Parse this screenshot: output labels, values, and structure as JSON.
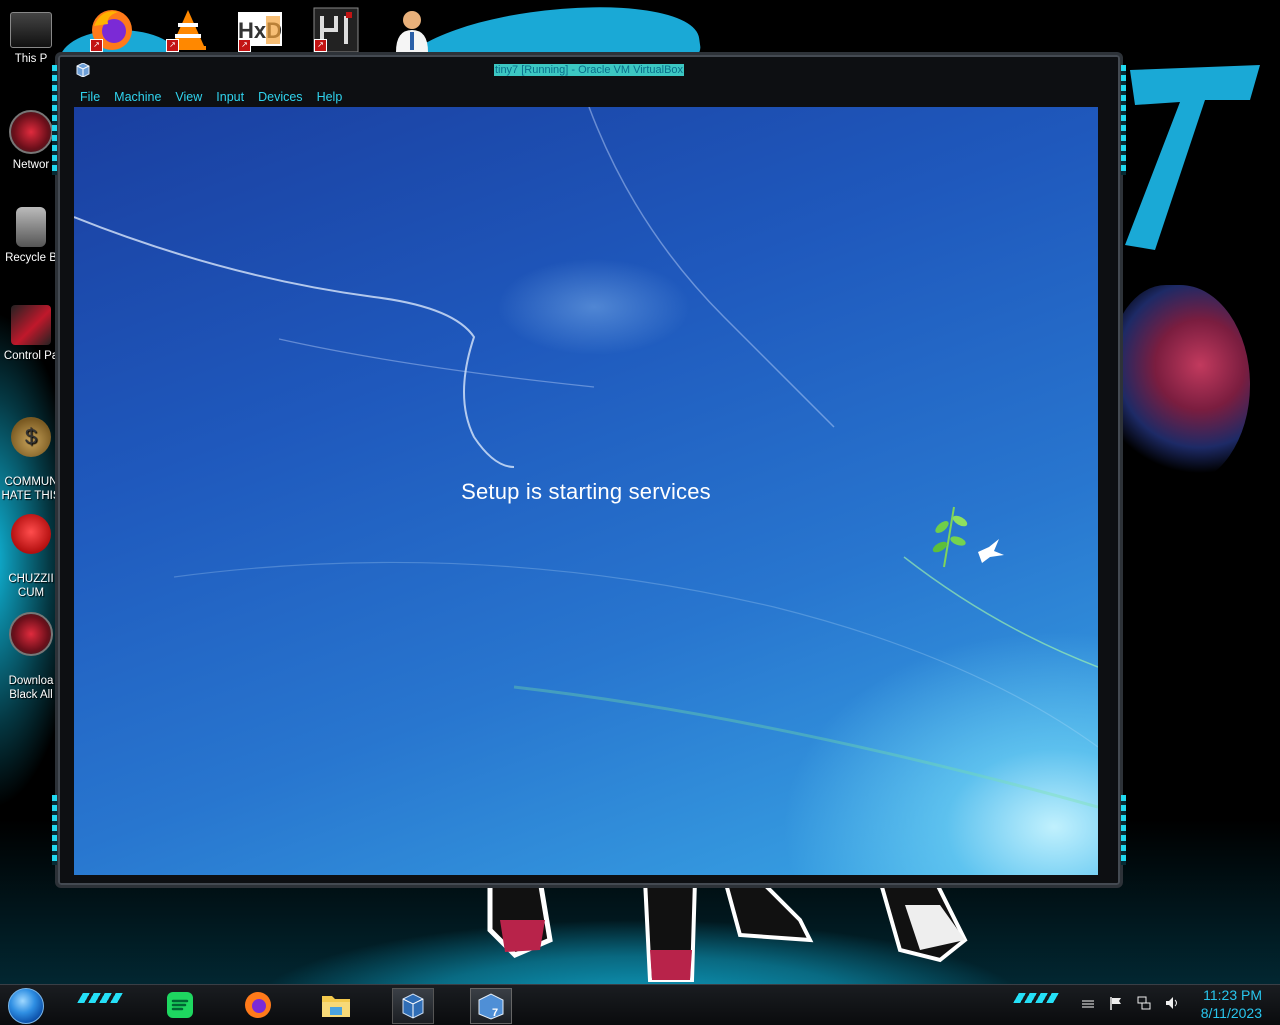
{
  "desktop": {
    "icons": [
      {
        "label": "This P",
        "icon": "this-pc-icon"
      },
      {
        "label": "Networ",
        "icon": "network-icon"
      },
      {
        "label": "Recycle B",
        "icon": "recycle-bin-icon"
      },
      {
        "label": "Control Pa",
        "icon": "control-panel-icon"
      },
      {
        "label": "COMMUN\nHATE THIS",
        "icon": "money-bag-icon"
      },
      {
        "label": "CHUZZII\nCUM",
        "icon": "chuzzle-icon"
      },
      {
        "label": "Downloa\nBlack All",
        "icon": "download-icon"
      }
    ],
    "top_icons": [
      "firefox-icon",
      "vlc-icon",
      "hxd-icon",
      "maze-icon",
      "doctor-icon"
    ]
  },
  "window": {
    "title": "tiny7 [Running] - Oracle VM VirtualBox",
    "menu": [
      "File",
      "Machine",
      "View",
      "Input",
      "Devices",
      "Help"
    ]
  },
  "vm": {
    "message": "Setup is starting services"
  },
  "taskbar": {
    "apps": [
      "spotify-icon",
      "firefox-icon",
      "file-explorer-icon",
      "virtualbox-icon",
      "windows7-vm-icon"
    ],
    "time": "11:23 PM",
    "date": "8/11/2023"
  },
  "colors": {
    "accent": "#30d4ef",
    "title_bg": "#3cc7c2",
    "clock": "#29c6ee"
  }
}
